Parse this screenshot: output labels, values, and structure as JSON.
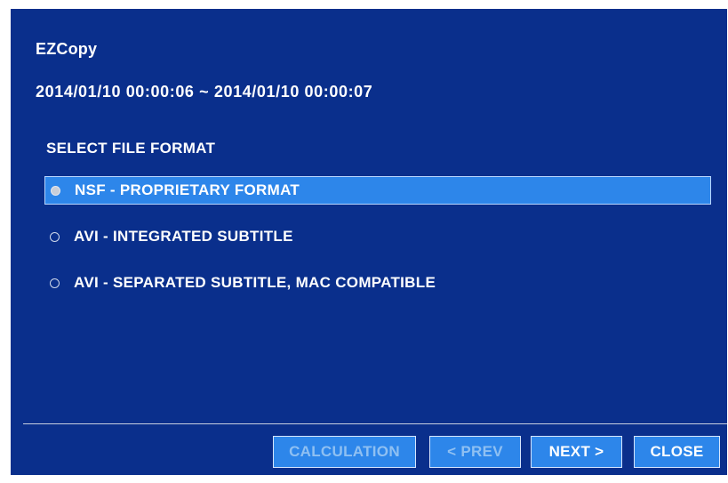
{
  "dialog": {
    "title": "EZCopy",
    "date_range": "2014/01/10 00:00:06 ~ 2014/01/10 00:00:07",
    "section_label": "SELECT FILE FORMAT",
    "options": [
      {
        "label": "NSF - PROPRIETARY FORMAT",
        "selected": true
      },
      {
        "label": "AVI - INTEGRATED SUBTITLE",
        "selected": false
      },
      {
        "label": "AVI - SEPARATED SUBTITLE, MAC COMPATIBLE",
        "selected": false
      }
    ]
  },
  "buttons": {
    "calculation": "CALCULATION",
    "prev": "< PREV",
    "next": "NEXT >",
    "close": "CLOSE"
  },
  "colors": {
    "background": "#0a2f8c",
    "highlight": "#2d86ea",
    "text": "#ffffff",
    "disabled_text": "#8fc0f2"
  }
}
